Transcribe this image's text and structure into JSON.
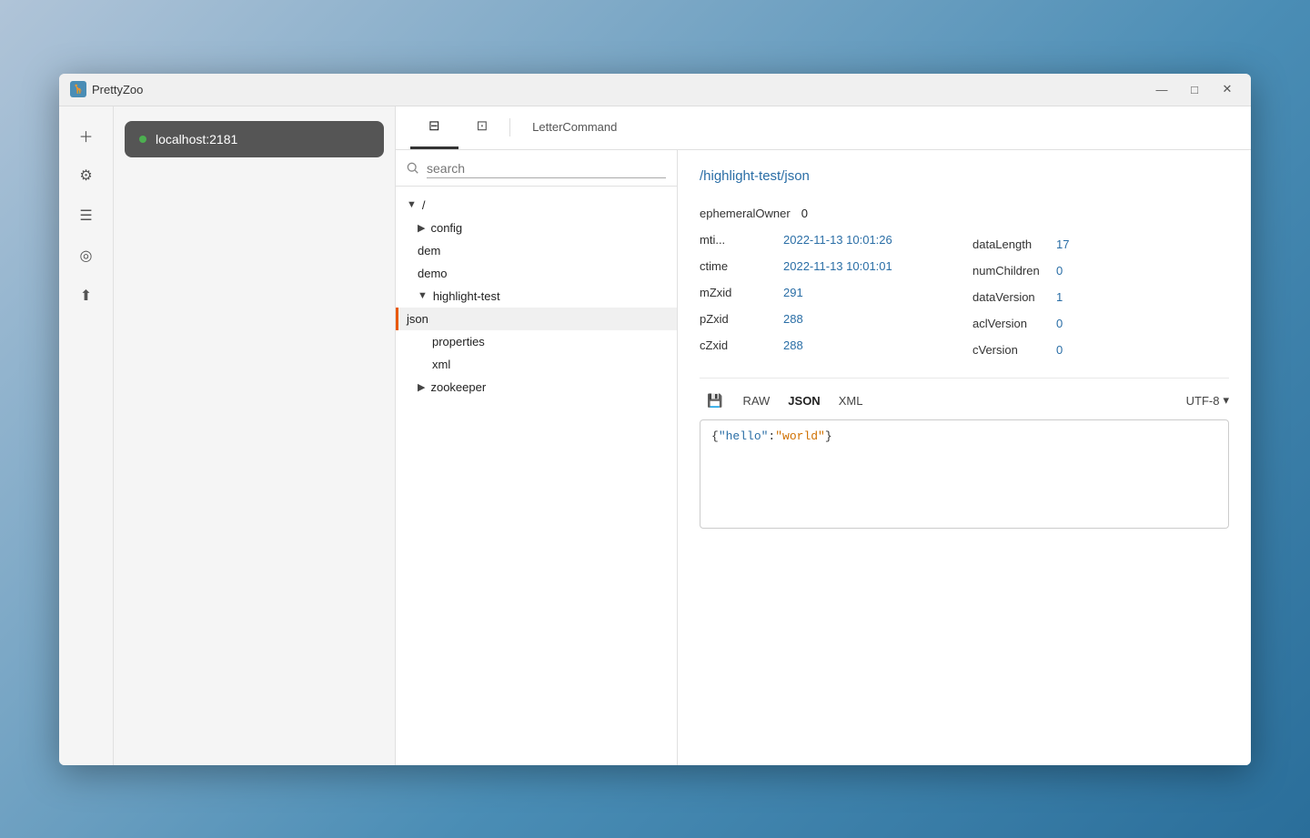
{
  "app": {
    "title": "PrettyZoo",
    "logo_char": "🦒"
  },
  "titlebar": {
    "minimize": "—",
    "maximize": "□",
    "close": "✕"
  },
  "sidebar": {
    "icons": [
      {
        "name": "add-icon",
        "glyph": "+"
      },
      {
        "name": "settings-icon",
        "glyph": "⚙"
      },
      {
        "name": "list-icon",
        "glyph": "☰"
      },
      {
        "name": "data-icon",
        "glyph": "◎"
      },
      {
        "name": "upload-icon",
        "glyph": "⬆"
      }
    ]
  },
  "connection": {
    "label": "localhost:2181"
  },
  "tabs": [
    {
      "id": "tree-tab",
      "icon": "⊟",
      "label": "",
      "active": true
    },
    {
      "id": "terminal-tab",
      "icon": "⊡",
      "label": "",
      "active": false
    },
    {
      "id": "letter-command-tab",
      "label": "LetterCommand",
      "active": false
    }
  ],
  "search": {
    "placeholder": "search"
  },
  "tree": {
    "items": [
      {
        "id": "root",
        "label": "/",
        "indent": 0,
        "expanded": true,
        "has_arrow": true,
        "arrow": "▼"
      },
      {
        "id": "config",
        "label": "config",
        "indent": 1,
        "expanded": false,
        "has_arrow": true,
        "arrow": "▶"
      },
      {
        "id": "dem",
        "label": "dem",
        "indent": 1,
        "expanded": false,
        "has_arrow": false
      },
      {
        "id": "demo",
        "label": "demo",
        "indent": 1,
        "expanded": false,
        "has_arrow": false
      },
      {
        "id": "highlight-test",
        "label": "highlight-test",
        "indent": 1,
        "expanded": true,
        "has_arrow": true,
        "arrow": "▼"
      },
      {
        "id": "json",
        "label": "json",
        "indent": 2,
        "expanded": false,
        "has_arrow": false,
        "selected": true
      },
      {
        "id": "properties",
        "label": "properties",
        "indent": 2,
        "expanded": false,
        "has_arrow": false
      },
      {
        "id": "xml",
        "label": "xml",
        "indent": 2,
        "expanded": false,
        "has_arrow": false
      },
      {
        "id": "zookeeper",
        "label": "zookeeper",
        "indent": 1,
        "expanded": false,
        "has_arrow": true,
        "arrow": "▶"
      }
    ]
  },
  "detail": {
    "path": "/highlight-test/json",
    "fields": [
      {
        "label": "ephemeralOwner",
        "value": "0",
        "colored": false
      },
      {
        "label": "mti...",
        "value": "2022-11-13 10:01:26",
        "colored": true
      },
      {
        "label": "dataLength",
        "value": "17",
        "colored": true
      },
      {
        "label": "ctime",
        "value": "2022-11-13 10:01:01",
        "colored": true
      },
      {
        "label": "numChildren",
        "value": "0",
        "colored": true
      },
      {
        "label": "mZxid",
        "value": "291",
        "colored": true
      },
      {
        "label": "dataVersion",
        "value": "1",
        "colored": true
      },
      {
        "label": "pZxid",
        "value": "288",
        "colored": true
      },
      {
        "label": "aclVersion",
        "value": "0",
        "colored": true
      },
      {
        "label": "cZxid",
        "value": "288",
        "colored": true
      },
      {
        "label": "cVersion",
        "value": "0",
        "colored": true
      }
    ],
    "data_editor": {
      "save_icon": "💾",
      "formats": [
        "RAW",
        "JSON",
        "XML"
      ],
      "active_format": "JSON",
      "encoding": "UTF-8",
      "content_raw": "{\"hello\":\"world\"}"
    }
  }
}
